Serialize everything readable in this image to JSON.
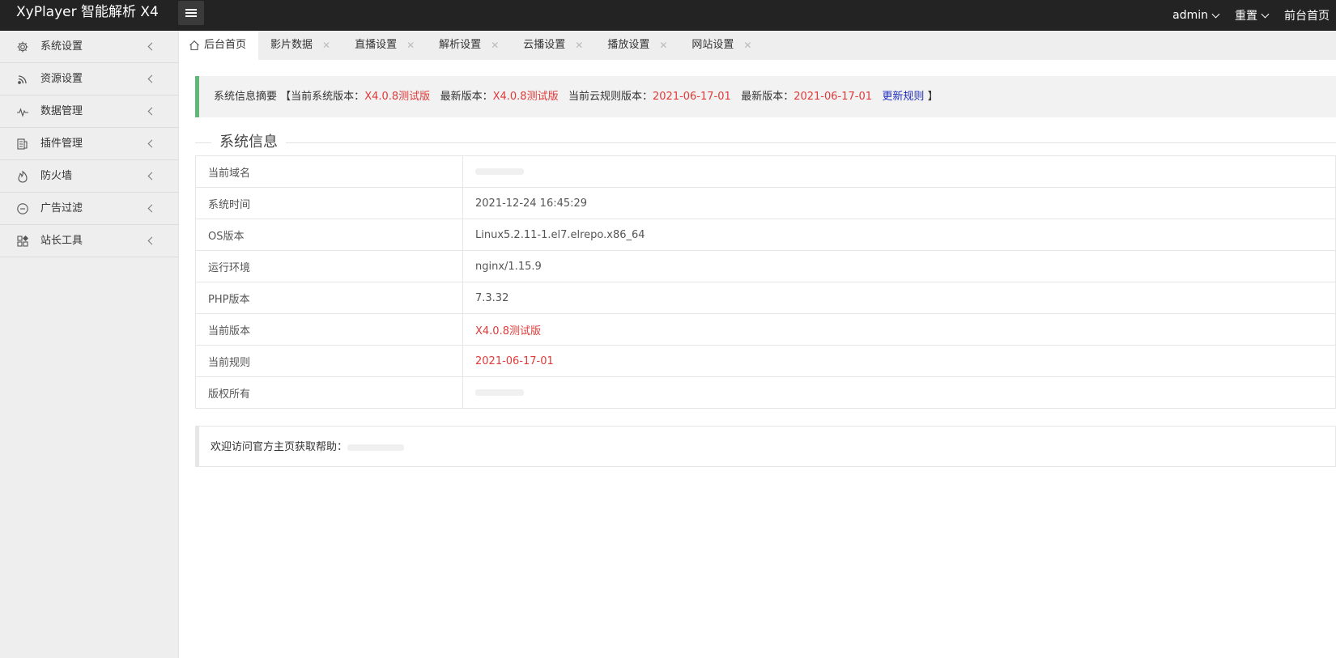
{
  "header": {
    "title": "XyPlayer 智能解析 X4",
    "user": "admin",
    "reset": "重置",
    "frontend": "前台首页"
  },
  "sidebar": {
    "items": [
      {
        "label": "系统设置",
        "icon": "gear-icon"
      },
      {
        "label": "资源设置",
        "icon": "rss-icon"
      },
      {
        "label": "数据管理",
        "icon": "pulse-icon"
      },
      {
        "label": "插件管理",
        "icon": "plugin-icon"
      },
      {
        "label": "防火墙",
        "icon": "fire-icon"
      },
      {
        "label": "广告过滤",
        "icon": "minus-circle-icon"
      },
      {
        "label": "站长工具",
        "icon": "apps-icon"
      }
    ]
  },
  "tabs": [
    {
      "label": "后台首页",
      "active": true
    },
    {
      "label": "影片数据"
    },
    {
      "label": "直播设置"
    },
    {
      "label": "解析设置"
    },
    {
      "label": "云播设置"
    },
    {
      "label": "播放设置"
    },
    {
      "label": "网站设置"
    }
  ],
  "summary": {
    "title": "系统信息摘要",
    "open_bracket": "【",
    "current_version_label": "当前系统版本：",
    "current_version": "X4.0.8测试版",
    "latest_version_label": "最新版本：",
    "latest_version": "X4.0.8测试版",
    "current_rule_label": "当前云规则版本：",
    "current_rule": "2021-06-17-01",
    "latest_rule_label": "最新版本：",
    "latest_rule": "2021-06-17-01",
    "update_link": "更新规则",
    "close_bracket": "】"
  },
  "system_info": {
    "legend": "系统信息",
    "rows": [
      {
        "key": "当前域名",
        "value": ""
      },
      {
        "key": "系统时间",
        "value": "2021-12-24 16:45:29"
      },
      {
        "key": "OS版本",
        "value": "Linux5.2.11-1.el7.elrepo.x86_64"
      },
      {
        "key": "运行环境",
        "value": "nginx/1.15.9"
      },
      {
        "key": "PHP版本",
        "value": "7.3.32"
      },
      {
        "key": "当前版本",
        "value": "X4.0.8测试版"
      },
      {
        "key": "当前规则",
        "value": "2021-06-17-01"
      },
      {
        "key": "版权所有",
        "value": ""
      }
    ]
  },
  "footer": {
    "text": "欢迎访问官方主页获取帮助："
  },
  "colors": {
    "header_bg": "#232323",
    "accent_green": "#5fb878",
    "highlight_red": "#e03a3a",
    "link_blue": "#1e2ebf"
  }
}
